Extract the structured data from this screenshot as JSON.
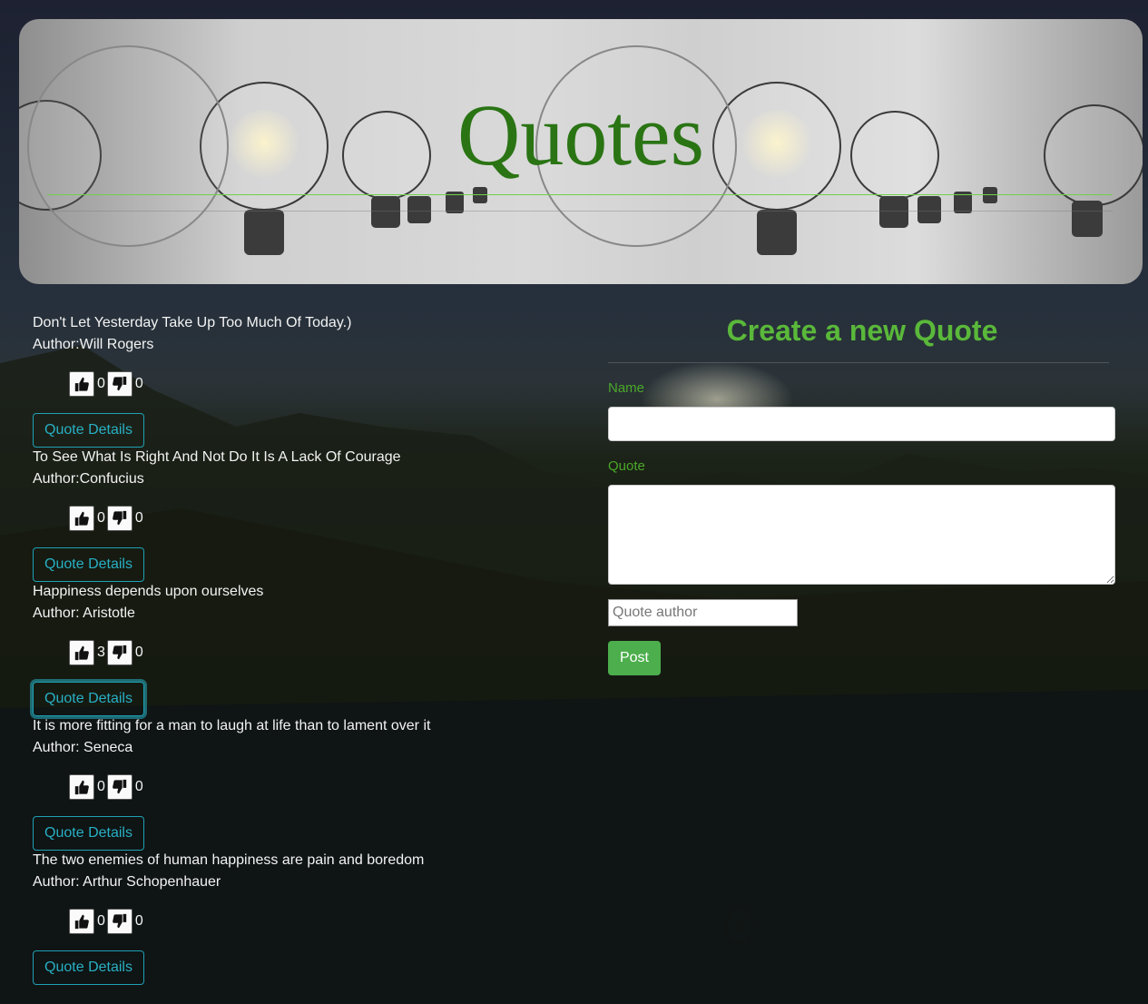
{
  "header": {
    "title": "Quotes"
  },
  "quotes": [
    {
      "text": "Don't Let Yesterday Take Up Too Much Of Today.)",
      "author": "Author:Will Rogers",
      "upvotes": "0",
      "downvotes": "0",
      "details_label": "Quote Details"
    },
    {
      "text": "To See What Is Right And Not Do It Is A Lack Of Courage",
      "author": "Author:Confucius",
      "upvotes": "0",
      "downvotes": "0",
      "details_label": "Quote Details"
    },
    {
      "text": "Happiness depends upon ourselves",
      "author": "Author: Aristotle",
      "upvotes": "3",
      "downvotes": "0",
      "details_label": "Quote Details"
    },
    {
      "text": "It is more fitting for a man to laugh at life than to lament over it",
      "author": "Author: Seneca",
      "upvotes": "0",
      "downvotes": "0",
      "details_label": "Quote Details"
    },
    {
      "text": "The two enemies of human happiness are pain and boredom",
      "author": "Author: Arthur Schopenhauer",
      "upvotes": "0",
      "downvotes": "0",
      "details_label": "Quote Details"
    }
  ],
  "form": {
    "title": "Create a new Quote",
    "name_label": "Name",
    "name_value": "",
    "quote_label": "Quote",
    "quote_value": "",
    "author_placeholder": "Quote author",
    "post_label": "Post"
  },
  "icons": {
    "upvote": "thumbs-up-icon",
    "downvote": "thumbs-down-icon"
  },
  "colors": {
    "accent_green": "#5ab83a",
    "title_green": "#2a7414",
    "details_teal": "#28b0c4",
    "post_green": "#4cae4c"
  }
}
